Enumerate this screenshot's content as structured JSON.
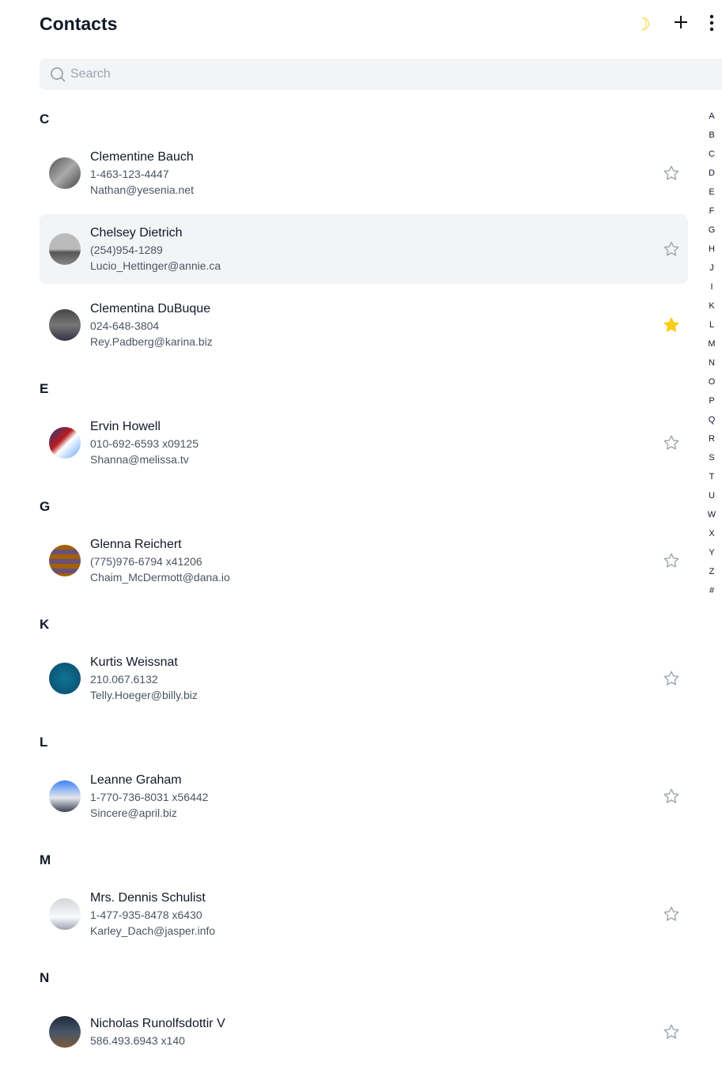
{
  "header": {
    "title": "Contacts",
    "theme_icon": "moon-icon",
    "add_icon": "plus-icon",
    "menu_icon": "more-vertical-icon"
  },
  "search": {
    "placeholder": "Search",
    "value": ""
  },
  "colors": {
    "star_active": "#facc15",
    "star_inactive": "#9ca3af",
    "highlight": "#f3f4f6"
  },
  "sections": [
    {
      "letter": "C",
      "contacts": [
        {
          "name": "Clementine Bauch",
          "phone": "1-463-123-4447",
          "email": "Nathan@yesenia.net",
          "starred": false,
          "avatar": "linear-gradient(135deg,#555,#aaa,#444)"
        },
        {
          "name": "Chelsey Dietrich",
          "phone": "(254)954-1289",
          "email": "Lucio_Hettinger@annie.ca",
          "starred": false,
          "highlight": true,
          "avatar": "linear-gradient(180deg,#bbb 50%,#555 60%,#888)"
        },
        {
          "name": "Clementina DuBuque",
          "phone": "024-648-3804",
          "email": "Rey.Padberg@karina.biz",
          "starred": true,
          "avatar": "linear-gradient(180deg,#444,#777 50%,#334)"
        }
      ]
    },
    {
      "letter": "E",
      "contacts": [
        {
          "name": "Ervin Howell",
          "phone": "010-692-6593 x09125",
          "email": "Shanna@melissa.tv",
          "starred": false,
          "avatar": "linear-gradient(135deg,#1e3a8a,#b91c1c 40%,#fff 55%,#60a5fa)"
        }
      ]
    },
    {
      "letter": "G",
      "contacts": [
        {
          "name": "Glenna Reichert",
          "phone": "(775)976-6794 x41206",
          "email": "Chaim_McDermott@dana.io",
          "starred": false,
          "avatar": "repeating-linear-gradient(180deg,#a16207 0 6px,#6b4f7a 6px 12px)"
        }
      ]
    },
    {
      "letter": "K",
      "contacts": [
        {
          "name": "Kurtis Weissnat",
          "phone": "210.067.6132",
          "email": "Telly.Hoeger@billy.biz",
          "starred": false,
          "avatar": "radial-gradient(circle,#0e7490,#0c4a6e)"
        }
      ]
    },
    {
      "letter": "L",
      "contacts": [
        {
          "name": "Leanne Graham",
          "phone": "1-770-736-8031 x56442",
          "email": "Sincere@april.biz",
          "starred": false,
          "avatar": "linear-gradient(180deg,#3b82f6,#e5e7eb 55%,#374151)"
        }
      ]
    },
    {
      "letter": "M",
      "contacts": [
        {
          "name": "Mrs. Dennis Schulist",
          "phone": "1-477-935-8478 x6430",
          "email": "Karley_Dach@jasper.info",
          "starred": false,
          "avatar": "linear-gradient(180deg,#d1d5db,#f9fafb 60%,#9ca3af)"
        }
      ]
    },
    {
      "letter": "N",
      "contacts": [
        {
          "name": "Nicholas Runolfsdottir V",
          "phone": "586.493.6943 x140",
          "email": "",
          "starred": false,
          "avatar": "linear-gradient(180deg,#1e293b,#475569 50%,#7c5a3a)"
        }
      ]
    }
  ],
  "alphabet": [
    "A",
    "B",
    "C",
    "D",
    "E",
    "F",
    "G",
    "H",
    "J",
    "I",
    "K",
    "L",
    "M",
    "N",
    "O",
    "P",
    "Q",
    "R",
    "S",
    "T",
    "U",
    "W",
    "X",
    "Y",
    "Z",
    "#"
  ]
}
